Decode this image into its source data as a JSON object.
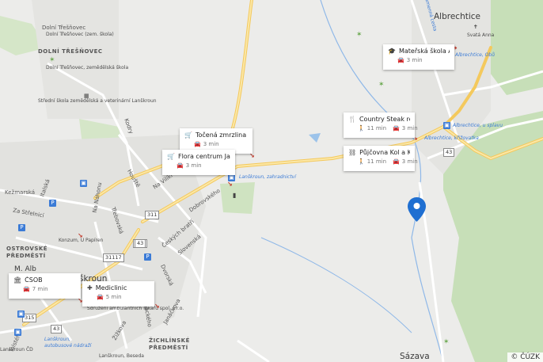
{
  "map": {
    "attribution": "© ČÚZK",
    "towns": {
      "albrechtice": "Albrechtice",
      "dolni_tresnovec": "DOLNÍ TŘEŠŇOVEC",
      "ostrovske": "OSTROVSKÉ\nPŘEDMĚSTÍ",
      "zichlinske": "ŽICHLÍNSKÉ\nPŘEDMĚSTÍ",
      "lanskroun": "Lanškroun",
      "sazava": "Sázava",
      "skroun": "škroun",
      "m_alb": "M. Alb"
    },
    "streets": [
      "Kežmarská",
      "Za Střelnicí",
      "Italská",
      "Na Náhonu",
      "Třebovská",
      "Houště",
      "Na Vilíkl",
      "Kodry",
      "Dobrovského",
      "Českých bratří",
      "Slovenská",
      "Dvorská",
      "Janáčkova",
      "Žižkova",
      "Tolstého",
      "Palackého",
      "Dolní Třešňovec",
      "Kamenná cesta"
    ],
    "small_labels": {
      "zem_skola": "Dolní Třešňovec\n(zem. škola)",
      "zemedelska": "Dolní Třešňovec,\nzemědělská škola",
      "stredni_skola": "Střední škola\nzemědělská a\nveterinární Lanškroun",
      "konzum": "Konzum, U Papíren",
      "svata_anna": "Svatá Anna",
      "sdruzeni": "Sdružení ambulantních\nlékařů spol. s r.o.",
      "beseda": "Lanškroun, Beseda",
      "lanskroun_cd": "Lanškroun ČD",
      "autobusove": "Lanškroun,\nautobusové nádraží"
    },
    "stops": {
      "zahradnictvi": "Lanškroun, zahradnictví",
      "albrechtice_obu": "Albrechtice, Obů",
      "albrechtice_splavu": "Albrechtice, u splavu",
      "albrechtice_krizovatka": "Albrechtice, křižovatka"
    },
    "road_numbers": [
      "43",
      "43",
      "311",
      "31117",
      "43",
      "315",
      "43"
    ],
    "place_cards": [
      {
        "icon": "graduation-cap-icon",
        "glyph": "🎓",
        "title": "Mateřská škola Al...",
        "walk": "",
        "drive": "3 min"
      },
      {
        "icon": "fork-knife-icon",
        "glyph": "🍴",
        "title": "Country Steak res...",
        "walk": "11 min",
        "drive": "3 min"
      },
      {
        "icon": "bike-rental-icon",
        "glyph": "⛓",
        "title": "Půjčovna Kol a Ko...",
        "walk": "11 min",
        "drive": "3 min"
      },
      {
        "icon": "cart-icon",
        "glyph": "🛒",
        "title": "Točená zmrzlina ...",
        "walk": "",
        "drive": "3 min"
      },
      {
        "icon": "cart-icon",
        "glyph": "🛒",
        "title": "Flora centrum Jan...",
        "walk": "",
        "drive": "3 min"
      },
      {
        "icon": "bank-icon",
        "glyph": "🏛",
        "title": "ČSOB",
        "walk": "",
        "drive": "7 min"
      },
      {
        "icon": "medical-plus-icon",
        "glyph": "✚",
        "title": "Mediclinic",
        "walk": "",
        "drive": "5 min"
      }
    ],
    "colors": {
      "background": "#ececea",
      "road": "#ffffff",
      "major_road": "#f7d36b",
      "forest": "#c7dfb8",
      "stream": "#8fb8e8",
      "marker": "#1f6fd1",
      "urban": "#e2e2df"
    }
  }
}
